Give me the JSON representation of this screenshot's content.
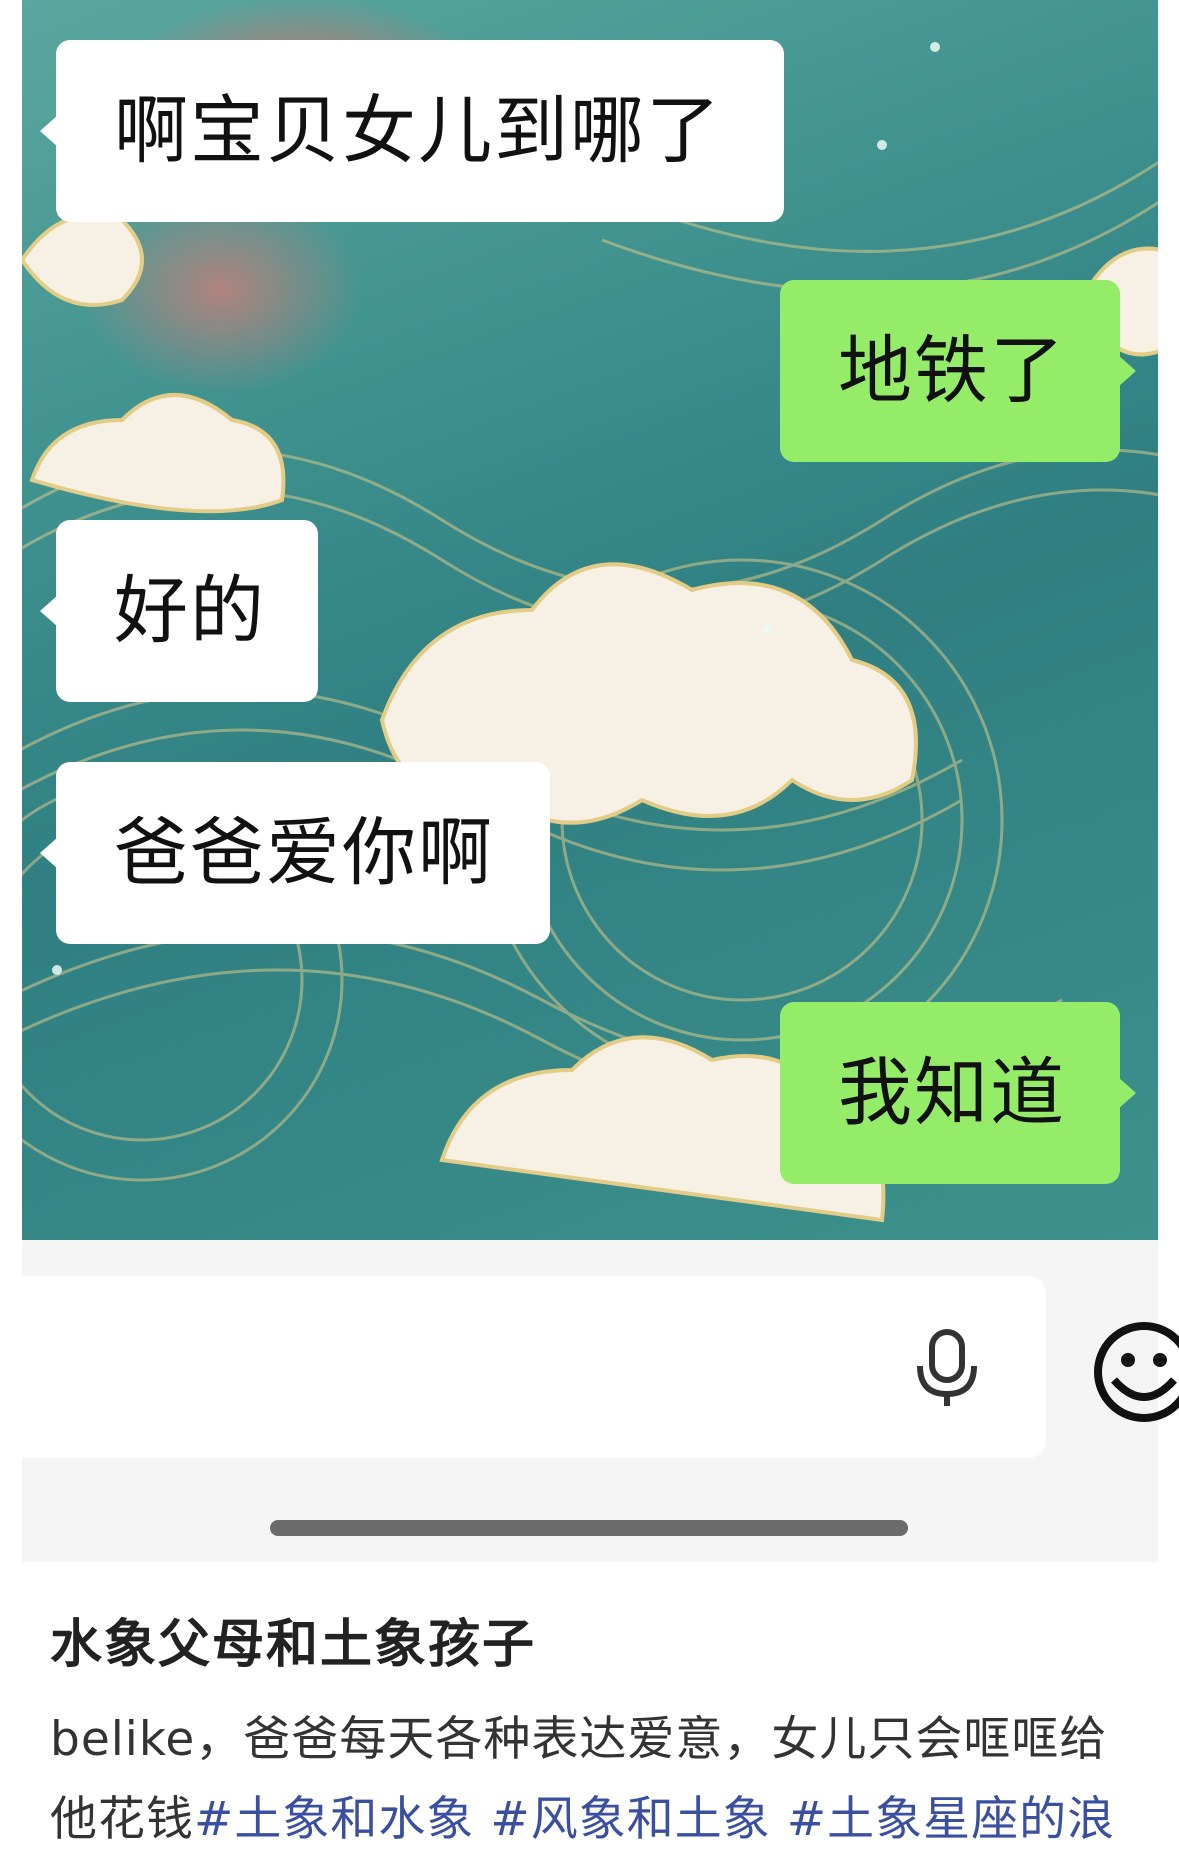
{
  "chat": {
    "messages": [
      {
        "side": "received",
        "text": "啊宝贝女儿到哪了"
      },
      {
        "side": "sent",
        "text": "地铁了"
      },
      {
        "side": "received",
        "text": "好的"
      },
      {
        "side": "received",
        "text": "爸爸爱你啊"
      },
      {
        "side": "sent",
        "text": "我知道"
      }
    ],
    "colors": {
      "received_bubble": "#ffffff",
      "sent_bubble": "#95ec69",
      "wallpaper": "#3b8e8c"
    }
  },
  "input_bar": {
    "mic_icon": "microphone-icon",
    "emoji_icon": "emoji-face-icon"
  },
  "post": {
    "title": "水象父母和土象孩子",
    "body_text": "belike，爸爸每天各种表达爱意，女儿只会哐哐给他花钱",
    "tags": [
      "#土象和水象",
      "#风象和土象",
      "#土象星座的浪"
    ],
    "tag_color": "#3a4fa0"
  }
}
